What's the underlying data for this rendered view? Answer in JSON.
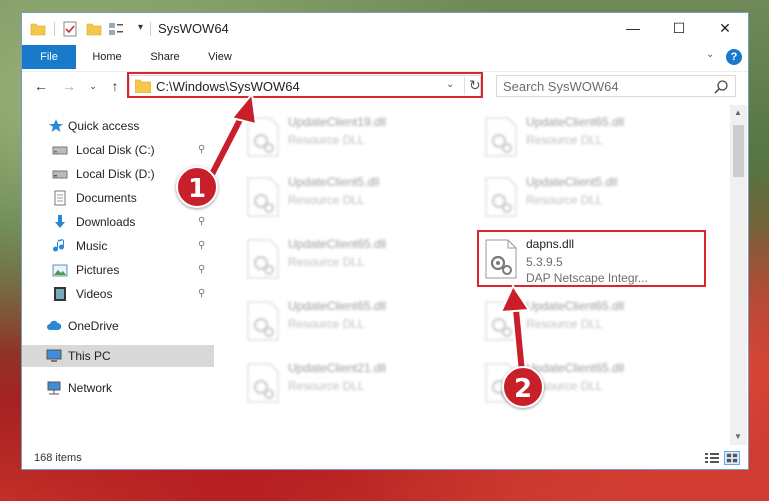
{
  "window": {
    "title": "SysWOW64",
    "minimize_glyph": "—",
    "maximize_glyph": "☐",
    "close_glyph": "✕"
  },
  "ribbon": {
    "tabs": [
      "File",
      "Home",
      "Share",
      "View"
    ]
  },
  "navigation": {
    "back_glyph": "←",
    "forward_glyph": "→",
    "recent_glyph": "⌄",
    "up_glyph": "↑",
    "address": "C:\\Windows\\SysWOW64",
    "search_placeholder": "Search SysWOW64"
  },
  "sidebar": {
    "items": [
      {
        "label": "Quick access",
        "icon": "star-icon",
        "pinned": false
      },
      {
        "label": "Local Disk (C:)",
        "icon": "drive-icon",
        "pinned": true
      },
      {
        "label": "Local Disk (D:)",
        "icon": "drive-icon",
        "pinned": false
      },
      {
        "label": "Documents",
        "icon": "documents-icon",
        "pinned": true
      },
      {
        "label": "Downloads",
        "icon": "download-icon",
        "pinned": true
      },
      {
        "label": "Music",
        "icon": "music-icon",
        "pinned": true
      },
      {
        "label": "Pictures",
        "icon": "pictures-icon",
        "pinned": true
      },
      {
        "label": "Videos",
        "icon": "videos-icon",
        "pinned": true
      },
      {
        "label": "OneDrive",
        "icon": "cloud-icon",
        "pinned": false
      },
      {
        "label": "This PC",
        "icon": "computer-icon",
        "pinned": false,
        "selected": true
      },
      {
        "label": "Network",
        "icon": "network-icon",
        "pinned": false
      }
    ],
    "pin_glyph": "📌"
  },
  "files": [
    {
      "name": "UpdateClient19.dll",
      "type": "Resource DLL",
      "blurred": true
    },
    {
      "name": "UpdateClient65.dll",
      "type": "Resource DLL",
      "blurred": true
    },
    {
      "name": "UpdateClient5.dll",
      "type": "Resource DLL",
      "blurred": true
    },
    {
      "name": "UpdateClient5.dll",
      "type": "Resource DLL",
      "blurred": true
    },
    {
      "name": "UpdateClient65.dll",
      "type": "Resource DLL",
      "blurred": true
    },
    {
      "name": "dapns.dll",
      "version": "5.3.9.5",
      "description": "DAP Netscape Integr...",
      "blurred": false
    },
    {
      "name": "UpdateClient65.dll",
      "type": "Resource DLL",
      "blurred": true
    },
    {
      "name": "UpdateClient65.dll",
      "type": "Resource DLL",
      "blurred": true
    },
    {
      "name": "UpdateClient21.dll",
      "type": "Resource DLL",
      "blurred": true
    },
    {
      "name": "UpdateClient65.dll",
      "type": "Resource DLL",
      "blurred": true
    }
  ],
  "status": {
    "item_count": "168 items"
  },
  "annotations": {
    "step1": "1",
    "step2": "2",
    "highlight_color": "#d9252b",
    "badge_color": "#c81f2a"
  },
  "colors": {
    "accent": "#1979ca",
    "selection": "#d9d9d9"
  }
}
